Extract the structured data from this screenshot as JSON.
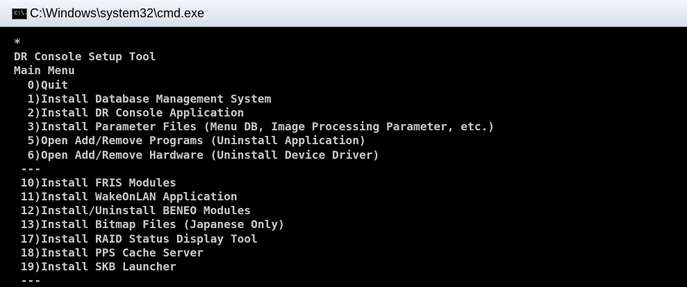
{
  "window": {
    "title": "C:\\Windows\\system32\\cmd.exe",
    "icon": "console-icon",
    "icon_glyph": "c:\\."
  },
  "console": {
    "lines": [
      "*",
      "DR Console Setup Tool",
      "Main Menu",
      "  0)Quit",
      "  1)Install Database Management System",
      "  2)Install DR Console Application",
      "  3)Install Parameter Files (Menu DB, Image Processing Parameter, etc.)",
      "  5)Open Add/Remove Programs (Uninstall Application)",
      "  6)Open Add/Remove Hardware (Uninstall Device Driver)",
      " ---",
      " 10)Install FRIS Modules",
      " 11)Install WakeOnLAN Application",
      " 12)Install/Uninstall BENEO Modules",
      " 13)Install Bitmap Files (Japanese Only)",
      " 17)Install RAID Status Display Tool",
      " 18)Install PPS Cache Server",
      " 19)Install SKB Launcher",
      " ---"
    ]
  },
  "colors": {
    "console_background": "#000000",
    "console_text": "#c9c9c9",
    "titlebar": "#e6ebf1"
  }
}
